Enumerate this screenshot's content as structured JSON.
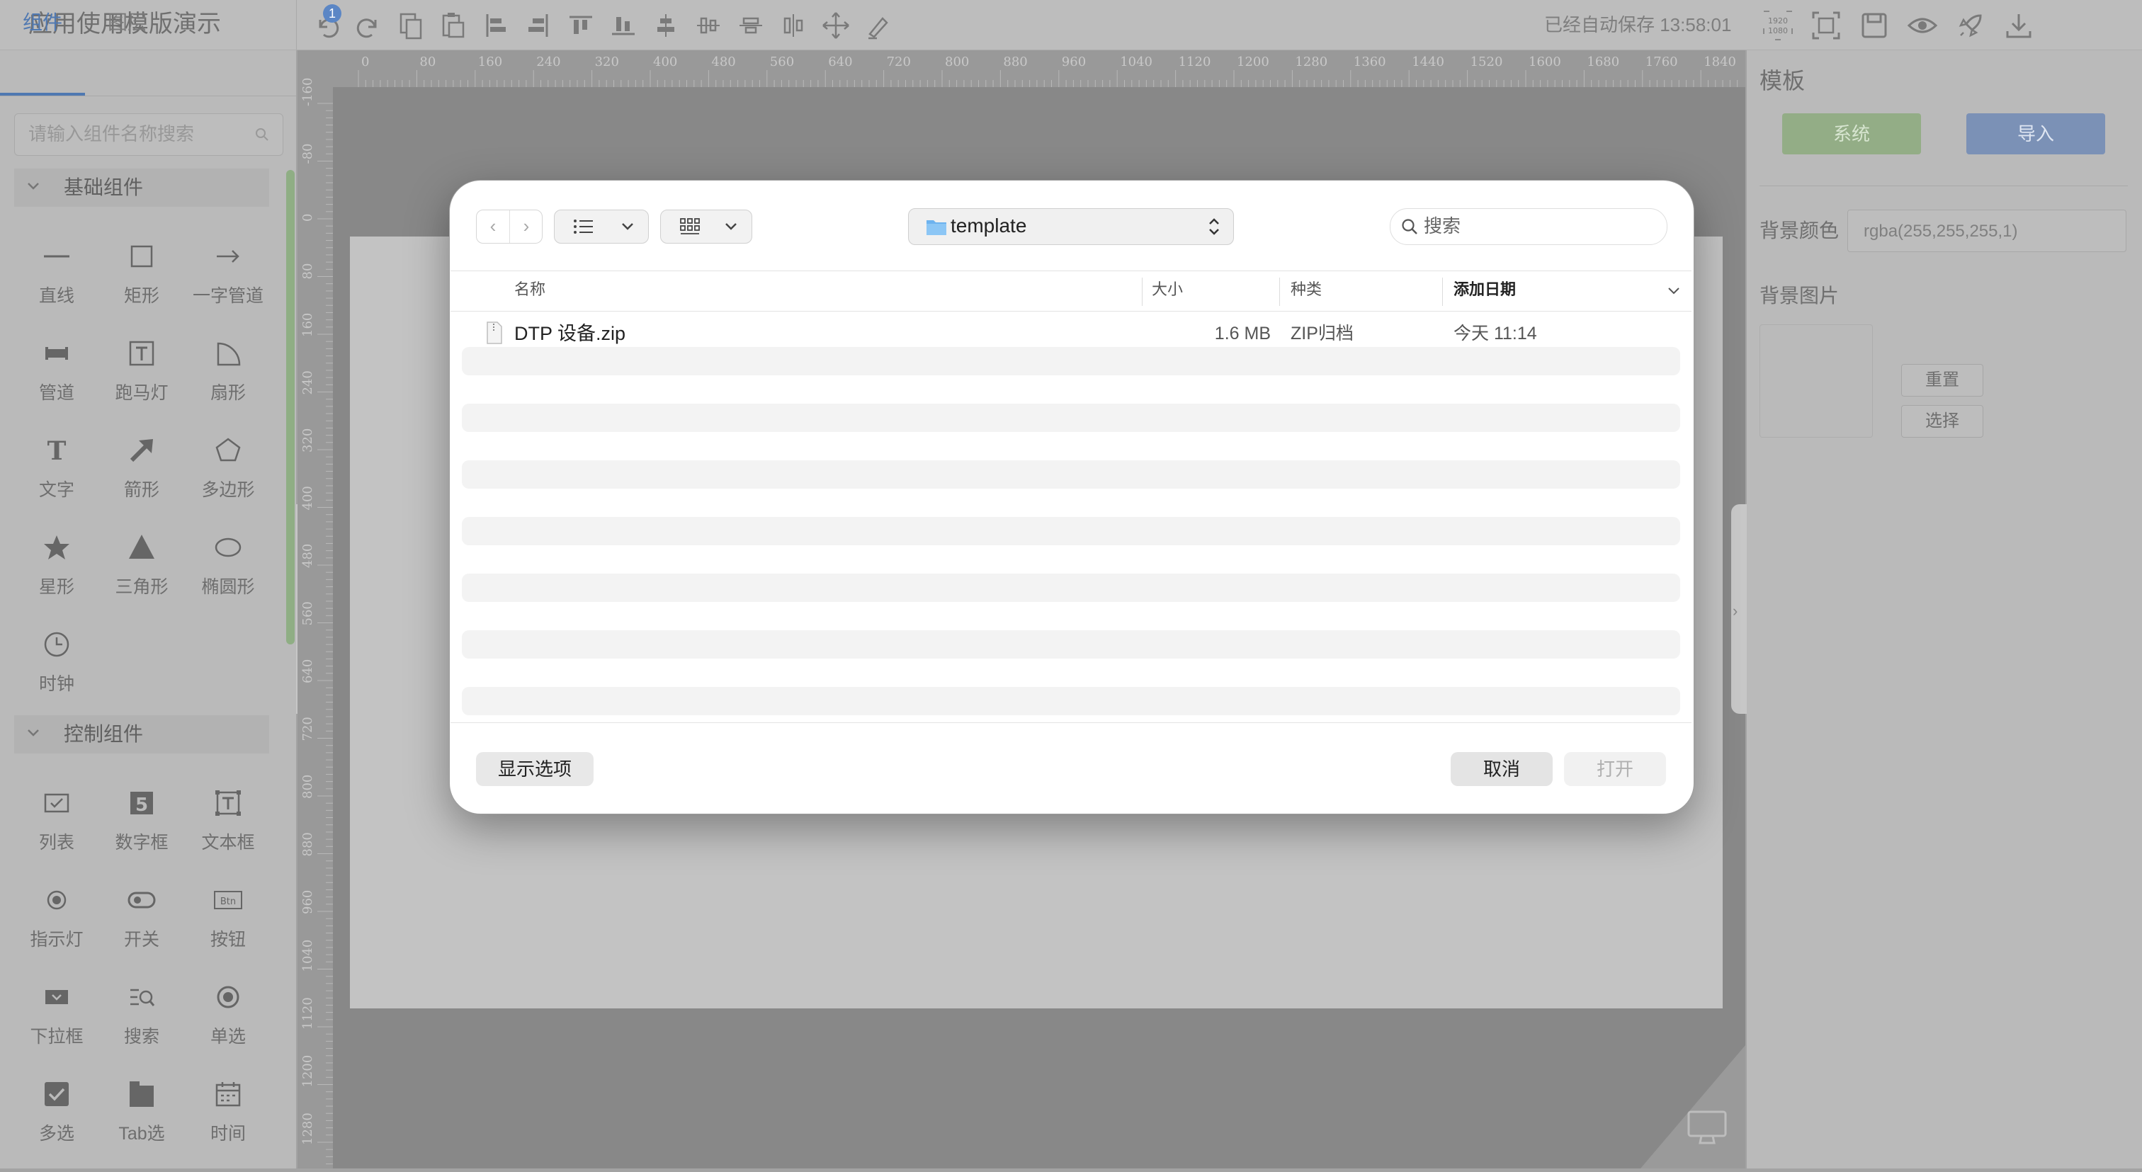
{
  "app": {
    "title": "应用使用模版演示",
    "undo_badge": "1",
    "autosave": "已经自动保存 13:58:01"
  },
  "toolbar_icons": [
    "undo-icon",
    "redo-icon",
    "copy-icon",
    "paste-icon",
    "align-left-icon",
    "align-right-icon",
    "align-top-icon",
    "align-bottom-icon",
    "align-center-h-icon",
    "align-center-v-icon",
    "distribute-h-icon",
    "distribute-v-icon",
    "move-icon",
    "brush-icon"
  ],
  "toolbar_right_icons": [
    "resolution-1920-1080-icon",
    "fit-screen-icon",
    "save-icon",
    "preview-eye-icon",
    "publish-rocket-icon",
    "download-icon"
  ],
  "sidebar": {
    "tabs": [
      "组件",
      "图层"
    ],
    "search_placeholder": "请输入组件名称搜索",
    "section_basic": "基础组件",
    "basic": [
      "直线",
      "矩形",
      "一字管道",
      "管道",
      "跑马灯",
      "扇形",
      "文字",
      "箭形",
      "多边形",
      "星形",
      "三角形",
      "椭圆形",
      "时钟"
    ],
    "section_control": "控制组件",
    "control": [
      "列表",
      "数字框",
      "文本框",
      "指示灯",
      "开关",
      "按钮",
      "下拉框",
      "搜索",
      "单选",
      "多选",
      "Tab选",
      "时间"
    ]
  },
  "ruler": {
    "top_ticks": [
      "0",
      "80",
      "160",
      "240",
      "320",
      "400",
      "480",
      "560",
      "640",
      "720",
      "800",
      "880",
      "960",
      "1040",
      "1120",
      "1200",
      "1280",
      "1360",
      "1440",
      "1520",
      "1600",
      "1680",
      "1760",
      "1840"
    ],
    "left_ticks": [
      "-160",
      "-80",
      "0",
      "80",
      "160",
      "240",
      "320",
      "400",
      "480",
      "560",
      "640",
      "720",
      "800",
      "880",
      "960",
      "1040",
      "1120",
      "1200",
      "1280"
    ]
  },
  "right_panel": {
    "title": "模板",
    "system_button": "系统",
    "import_button": "导入",
    "bg_color_label": "背景颜色",
    "bg_color_value": "rgba(255,255,255,1)",
    "bg_image_label": "背景图片",
    "reset_button": "重置",
    "choose_button": "选择"
  },
  "dialog": {
    "folder": "template",
    "search_placeholder": "搜索",
    "columns": {
      "name": "名称",
      "size": "大小",
      "kind": "种类",
      "date_added": "添加日期"
    },
    "files": [
      {
        "name": "DTP 设备.zip",
        "size": "1.6 MB",
        "kind": "ZIP归档",
        "date": "今天 11:14"
      }
    ],
    "show_options": "显示选项",
    "cancel": "取消",
    "open": "打开"
  },
  "colors": {
    "accent_blue": "#4f78b1",
    "system_green": "#93ad86",
    "import_blue": "#7b91b6"
  }
}
